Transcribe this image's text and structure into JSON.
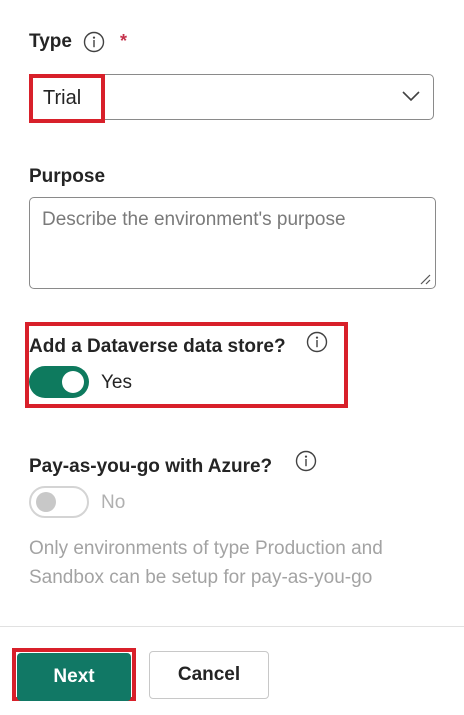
{
  "type_field": {
    "label": "Type",
    "required_marker": "*",
    "selected_value": "Trial",
    "icon": "info-icon"
  },
  "purpose_field": {
    "label": "Purpose",
    "placeholder": "Describe the environment's purpose",
    "value": ""
  },
  "dataverse": {
    "label": "Add a Dataverse data store?",
    "toggle_state": "on",
    "toggle_text": "Yes"
  },
  "payg": {
    "label": "Pay-as-you-go with Azure?",
    "toggle_state": "off",
    "toggle_text": "No",
    "disabled": true,
    "helper_text": "Only environments of type Production and Sandbox can be setup for pay-as-you-go"
  },
  "footer": {
    "next_label": "Next",
    "cancel_label": "Cancel"
  },
  "colors": {
    "accent": "#117865",
    "highlight": "#d8202a",
    "required": "#c4314b"
  }
}
